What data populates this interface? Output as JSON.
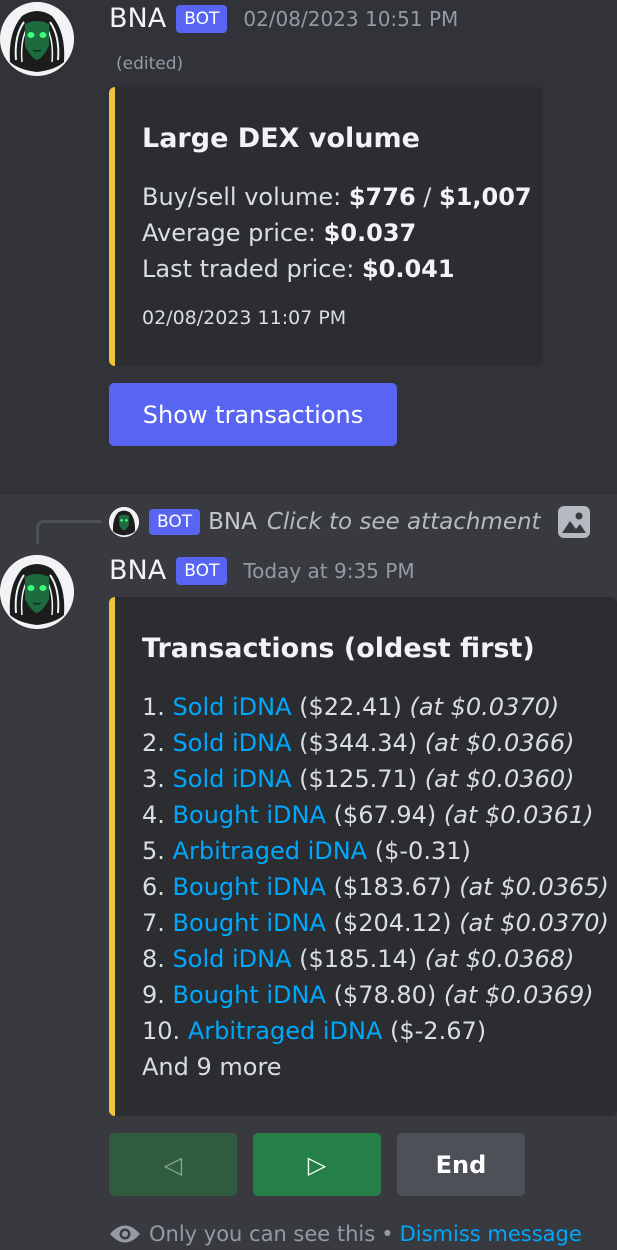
{
  "message1": {
    "author": "BNA",
    "bot_tag": "BOT",
    "timestamp": "02/08/2023 10:51 PM",
    "edited": "(edited)",
    "embed": {
      "accent_color": "#f0c43f",
      "title": "Large DEX volume",
      "volume_label": "Buy/sell volume:",
      "buy_volume": "$776",
      "separator": "/",
      "sell_volume": "$1,007",
      "avg_label": "Average price:",
      "avg_price": "$0.037",
      "last_label": "Last traded price:",
      "last_price": "$0.041",
      "footer": "02/08/2023 11:07 PM"
    },
    "button_label": "Show transactions"
  },
  "reply": {
    "bot_tag": "BOT",
    "author": "BNA",
    "text": "Click to see attachment",
    "icon": "image-icon"
  },
  "message2": {
    "author": "BNA",
    "bot_tag": "BOT",
    "timestamp": "Today at 9:35 PM",
    "embed": {
      "accent_color": "#f0c43f",
      "title": "Transactions (oldest first)",
      "transactions": [
        {
          "num": "1.",
          "action": "Sold iDNA",
          "amount": "($22.41)",
          "at": "(at $0.0370)"
        },
        {
          "num": "2.",
          "action": "Sold iDNA",
          "amount": "($344.34)",
          "at": "(at $0.0366)"
        },
        {
          "num": "3.",
          "action": "Sold iDNA",
          "amount": "($125.71)",
          "at": "(at $0.0360)"
        },
        {
          "num": "4.",
          "action": "Bought iDNA",
          "amount": "($67.94)",
          "at": "(at $0.0361)"
        },
        {
          "num": "5.",
          "action": "Arbitraged iDNA",
          "amount": "($-0.31)",
          "at": ""
        },
        {
          "num": "6.",
          "action": "Bought iDNA",
          "amount": "($183.67)",
          "at": "(at $0.0365)"
        },
        {
          "num": "7.",
          "action": "Bought iDNA",
          "amount": "($204.12)",
          "at": "(at $0.0370)"
        },
        {
          "num": "8.",
          "action": "Sold iDNA",
          "amount": "($185.14)",
          "at": "(at $0.0368)"
        },
        {
          "num": "9.",
          "action": "Bought iDNA",
          "amount": "($78.80)",
          "at": "(at $0.0369)"
        },
        {
          "num": "10.",
          "action": "Arbitraged iDNA",
          "amount": "($-2.67)",
          "at": ""
        }
      ],
      "more": "And 9 more"
    },
    "buttons": {
      "prev": "◁",
      "next": "▷",
      "end": "End"
    },
    "ephemeral": {
      "icon": "eye-icon",
      "text": "Only you can see this",
      "separator": "•",
      "dismiss": "Dismiss message"
    }
  }
}
